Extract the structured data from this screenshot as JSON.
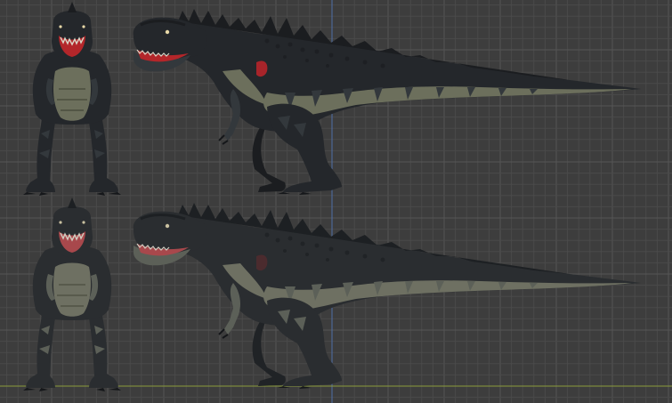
{
  "viewport": {
    "background": "#3d3d3d",
    "grid_minor_color": "#4a4a4a",
    "grid_major_color": "#555555",
    "axis_x_color": "#8a9a3c",
    "axis_y_color": "#4e6ea8"
  },
  "palette": {
    "body_dark": "#24272b",
    "body_mid": "#33383c",
    "belly_light": "#6c6f5c",
    "belly_shadow": "#535645",
    "spines": "#1b1d20",
    "mouth_red": "#b3262a",
    "mouth_red_dark": "#7b1c1e",
    "teeth": "#d9d5c6",
    "claws": "#15171a",
    "eye": "#e8d9a8"
  },
  "models": [
    {
      "view": "front",
      "variant": "dark"
    },
    {
      "view": "side",
      "variant": "dark"
    },
    {
      "view": "front",
      "variant": "light"
    },
    {
      "view": "side",
      "variant": "light"
    }
  ]
}
